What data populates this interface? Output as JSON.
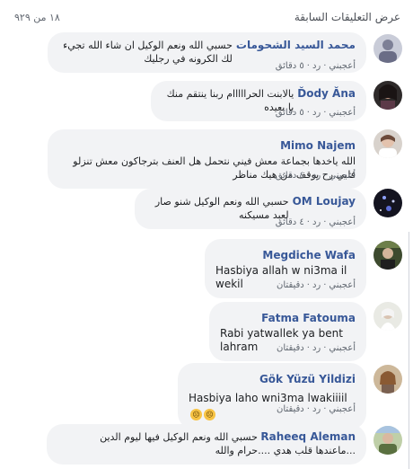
{
  "header": {
    "previous_comments_label": "عرض التعليقات السابقة",
    "count_label": "١٨ من ٩٢٩"
  },
  "comments": [
    {
      "author": "محمد السيد الشحومات",
      "text": "حسبي الله ونعم الوكيل ان شاء الله تجيء لك الكرونه في رجليك",
      "like": "أعجبني",
      "reply": "رد",
      "time": "٥ دقائق"
    },
    {
      "author": "Ďody Ăna",
      "text": "يالابنت الحرااااام ربنا ينتقم منك يا بعيده",
      "like": "أعجبني",
      "reply": "رد",
      "time": "٥ دقائق"
    },
    {
      "author": "Mimo Najem",
      "text": "الله ياخدها بجماعة معش فيني نتحمل هل العنف بترجاكون معش تنزلو فلبي رح يوقف من هيك مناظر",
      "like": "أعجبني",
      "reply": "رد",
      "time": "٤ دقائق"
    },
    {
      "author": "OM Loujay",
      "text": "حسبي الله ونعم الوكيل شنو صار لعبد مسيكنه",
      "like": "أعجبني",
      "reply": "رد",
      "time": "٤ دقائق"
    },
    {
      "author": "Megdiche Wafa",
      "text": "Hasbiya allah w ni3ma il wekil",
      "like": "أعجبني",
      "reply": "رد",
      "time": "دقيقتان"
    },
    {
      "author": "Fatma Fatouma",
      "text": "Rabi yatwallek ya bent lahram",
      "like": "أعجبني",
      "reply": "رد",
      "time": "دقيقتان"
    },
    {
      "author": "Gök Yüzü Yildizi",
      "text": "Hasbiya laho wni3ma lwakiiiil",
      "like": "أعجبني",
      "reply": "رد",
      "time": "دقيقتان"
    },
    {
      "author": "Raheeq Aleman",
      "text": "حسبي الله ونعم الوكيل فيها ليوم الدين ...ماعندها قلب هدي ....حرام والله",
      "like": "",
      "reply": "",
      "time": ""
    }
  ],
  "colors": {
    "author_link": "#385898",
    "bubble_bg": "#f2f3f5",
    "meta_text": "#606770"
  }
}
